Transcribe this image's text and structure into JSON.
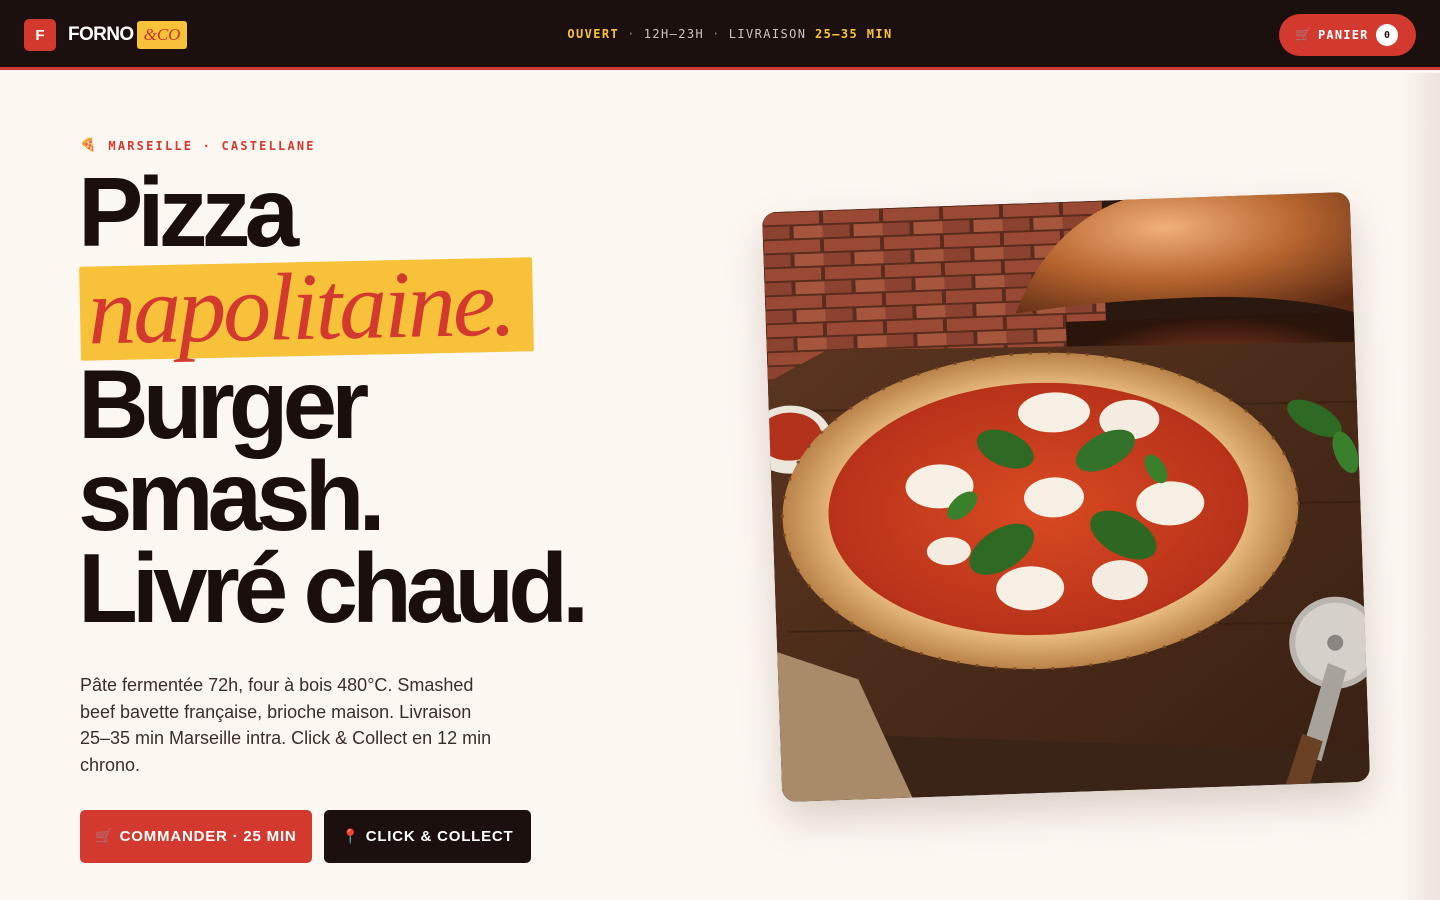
{
  "header": {
    "logo_letter": "F",
    "logo_word": "FORNO",
    "logo_tag": "&CO",
    "status_open": "OUVERT",
    "status_hours": "12H–23H",
    "status_delivery_label": "LIVRAISON",
    "status_delivery_time": "25–35 MIN",
    "cart_icon": "cart-icon",
    "cart_label": "PANIER",
    "cart_count": "0"
  },
  "hero": {
    "location_icon": "pizza-slice-icon",
    "location": "MARSEILLE · CASTELLANE",
    "headline": {
      "line1": "Pizza",
      "accent": "napolitaine.",
      "line3": "Burger",
      "line4": "smash.",
      "line5": "Livré chaud."
    },
    "intro": "Pâte fermentée 72h, four à bois 480°C. Smashed beef bavette française, brioche maison. Livraison 25–35 min Marseille intra. Click & Collect en 12 min chrono.",
    "cta_order": {
      "icon": "cart-icon",
      "label": "COMMANDER · 25 MIN"
    },
    "cta_collect": {
      "icon": "pin-icon",
      "label": "CLICK & COLLECT"
    }
  },
  "colors": {
    "brand_red": "#d3392f",
    "brand_yellow": "#f7c23a",
    "dark": "#1c100e",
    "background": "#fdf7f2"
  }
}
